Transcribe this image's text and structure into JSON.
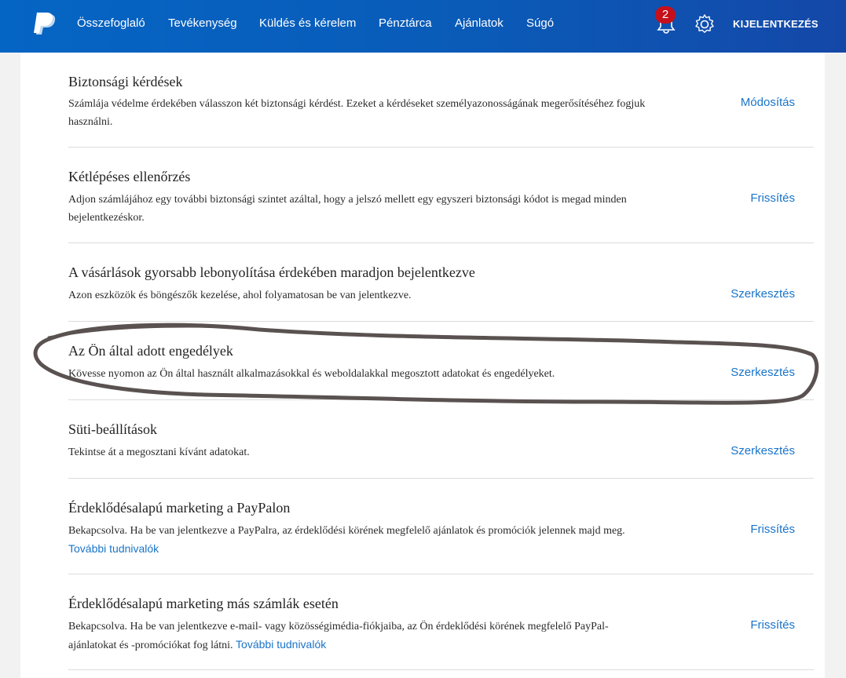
{
  "nav": {
    "items": [
      "Összefoglaló",
      "Tevékenység",
      "Küldés és kérelem",
      "Pénztárca",
      "Ajánlatok",
      "Súgó"
    ],
    "notification_count": "2",
    "logout_label": "KIJELENTKEZÉS"
  },
  "sections": [
    {
      "title": "Biztonsági kérdések",
      "description": "Számlája védelme érdekében válasszon két biztonsági kérdést. Ezeket a kérdéseket személyazonosságának megerősítéséhez fogjuk használni.",
      "action": "Módosítás"
    },
    {
      "title": "Kétlépéses ellenőrzés",
      "description": "Adjon számlájához egy további biztonsági szintet azáltal, hogy a jelszó mellett egy egyszeri biztonsági kódot is megad minden bejelentkezéskor.",
      "action": "Frissítés"
    },
    {
      "title": "A vásárlások gyorsabb lebonyolítása érdekében maradjon bejelentkezve",
      "description": "Azon eszközök és böngészők kezelése, ahol folyamatosan be van jelentkezve.",
      "action": "Szerkesztés"
    },
    {
      "title": "Az Ön által adott engedélyek",
      "description": "Kövesse nyomon az Ön által használt alkalmazásokkal és weboldalakkal megosztott adatokat és engedélyeket.",
      "action": "Szerkesztés"
    },
    {
      "title": "Süti-beállítások",
      "description": "Tekintse át a megosztani kívánt adatokat.",
      "action": "Szerkesztés"
    },
    {
      "title": "Érdeklődésalapú marketing a PayPalon",
      "description": "Bekapcsolva. Ha be van jelentkezve a PayPalra, az érdeklődési körének megfelelő ajánlatok és promóciók jelennek majd meg.",
      "link": "További tudnivalók",
      "action": "Frissítés"
    },
    {
      "title": "Érdeklődésalapú marketing más számlák esetén",
      "description": "Bekapcsolva. Ha be van jelentkezve e-mail- vagy közösségimédia-fiókjaiba, az Ön érdeklődési körének megfelelő PayPal-ajánlatokat és -promóciókat fog látni.",
      "link": "További tudnivalók",
      "action": "Frissítés"
    }
  ],
  "colors": {
    "header": "#0a5bb8",
    "link": "#1a74c9",
    "badge": "#c5101b",
    "annotation": "#5a5250"
  },
  "icons": [
    "paypal-logo-icon",
    "bell-icon",
    "gear-icon"
  ]
}
